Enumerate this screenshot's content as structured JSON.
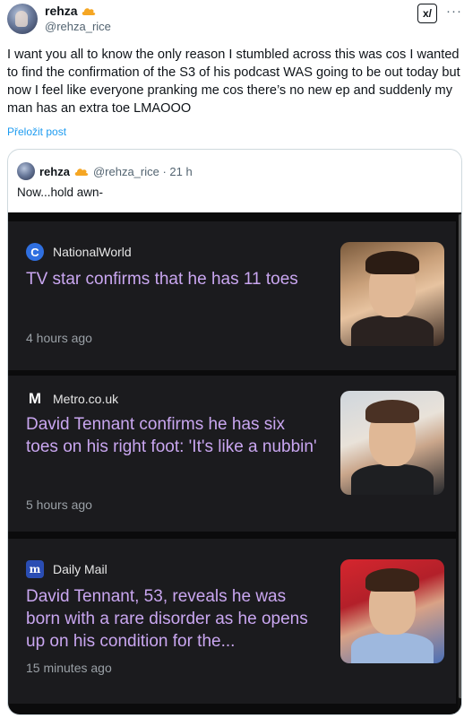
{
  "tweet": {
    "name": "rehza",
    "handle": "@rehza_rice",
    "text": "I want you all to know the only reason I stumbled across this was cos I wanted to find the confirmation of the S3 of his podcast WAS going to be out today but now I feel like everyone pranking me cos there’s no new ep and suddenly my man has an extra toe LMAOOO",
    "translate": "Přeložit post",
    "grok_label": "x/",
    "more_label": "···"
  },
  "quote": {
    "name": "rehza",
    "handle_time": "@rehza_rice · 21 h",
    "text": "Now...hold awn-"
  },
  "articles": [
    {
      "source": "NationalWorld",
      "logo": "C",
      "headline": "TV star confirms that he has 11 toes",
      "age": "4 hours ago"
    },
    {
      "source": "Metro.co.uk",
      "logo": "M",
      "headline": "David Tennant confirms he has six toes on his right foot: 'It's like a nubbin'",
      "age": "5 hours ago"
    },
    {
      "source": "Daily Mail",
      "logo": "m",
      "headline": "David Tennant, 53, reveals he was born with a rare disorder as he opens up on his condition for the...",
      "age": "15 minutes ago"
    }
  ],
  "colors": {
    "link": "#1d9bf0",
    "headline": "#c9a6f0",
    "card_bg": "#1b1b1e",
    "cloud": "#f5a623"
  }
}
